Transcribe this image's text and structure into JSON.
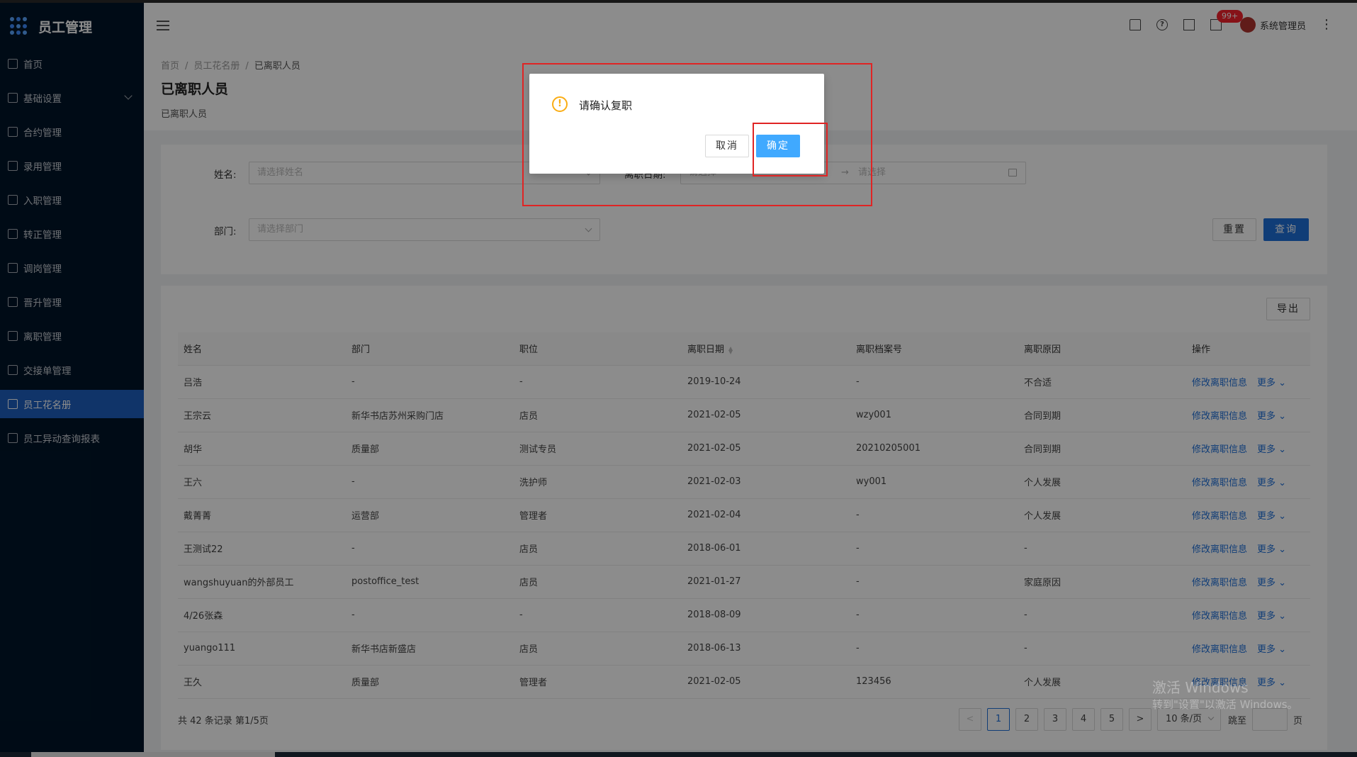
{
  "app": {
    "title": "员工管理"
  },
  "sidebar": {
    "items": [
      {
        "label": "首页",
        "icon": "home-icon"
      },
      {
        "label": "基础设置",
        "icon": "settings-icon",
        "expandable": true
      },
      {
        "label": "合约管理",
        "icon": "contract-icon"
      },
      {
        "label": "录用管理",
        "icon": "hire-icon"
      },
      {
        "label": "入职管理",
        "icon": "onboard-icon"
      },
      {
        "label": "转正管理",
        "icon": "regular-icon"
      },
      {
        "label": "调岗管理",
        "icon": "transfer-icon"
      },
      {
        "label": "晋升管理",
        "icon": "promotion-icon"
      },
      {
        "label": "离职管理",
        "icon": "resign-icon"
      },
      {
        "label": "交接单管理",
        "icon": "handover-icon"
      },
      {
        "label": "员工花名册",
        "icon": "roster-icon",
        "active": true
      },
      {
        "label": "员工异动查询报表",
        "icon": "report-icon"
      }
    ]
  },
  "header": {
    "badge": "99+",
    "username": "系统管理员"
  },
  "breadcrumb": {
    "home": "首页",
    "roster": "员工花名册",
    "current": "已离职人员"
  },
  "page": {
    "title": "已离职人员",
    "desc": "已离职人员"
  },
  "search": {
    "name_label": "姓名:",
    "name_placeholder": "请选择姓名",
    "date_label": "离职日期:",
    "date_start_placeholder": "请选择",
    "date_end_placeholder": "请选择",
    "dept_label": "部门:",
    "dept_placeholder": "请选择部门",
    "reset": "重置",
    "query": "查询"
  },
  "table": {
    "export": "导出",
    "columns": [
      "姓名",
      "部门",
      "职位",
      "离职日期",
      "离职档案号",
      "离职原因",
      "操作"
    ],
    "action_edit": "修改离职信息",
    "action_more": "更多",
    "rows": [
      [
        "吕浩",
        "-",
        "-",
        "2019-10-24",
        "-",
        "不合适"
      ],
      [
        "王宗云",
        "新华书店苏州采购门店",
        "店员",
        "2021-02-05",
        "wzy001",
        "合同到期"
      ],
      [
        "胡华",
        "质量部",
        "测试专员",
        "2021-02-05",
        "20210205001",
        "合同到期"
      ],
      [
        "王六",
        "-",
        "洗护师",
        "2021-02-03",
        "wy001",
        "个人发展"
      ],
      [
        "戴菁菁",
        "运营部",
        "管理者",
        "2021-02-04",
        "-",
        "个人发展"
      ],
      [
        "王测试22",
        "-",
        "店员",
        "2018-06-01",
        "-",
        "-"
      ],
      [
        "wangshuyuan的外部员工",
        "postoffice_test",
        "店员",
        "2021-01-27",
        "-",
        "家庭原因"
      ],
      [
        "4/26张森",
        "-",
        "-",
        "2018-08-09",
        "-",
        "-"
      ],
      [
        "yuango111",
        "新华书店新盛店",
        "店员",
        "2018-06-13",
        "-",
        "-"
      ],
      [
        "王久",
        "质量部",
        "管理者",
        "2021-02-05",
        "123456",
        "个人发展"
      ]
    ]
  },
  "pagination": {
    "total_text": "共 42 条记录 第1/5页",
    "pages": [
      "1",
      "2",
      "3",
      "4",
      "5"
    ],
    "current": "1",
    "page_size": "10 条/页",
    "jump_label": "跳至",
    "page_unit": "页"
  },
  "modal": {
    "title": "请确认复职",
    "cancel": "取消",
    "ok": "确定"
  },
  "watermark": {
    "line1": "激活 Windows",
    "line2": "转到\"设置\"以激活 Windows。"
  }
}
